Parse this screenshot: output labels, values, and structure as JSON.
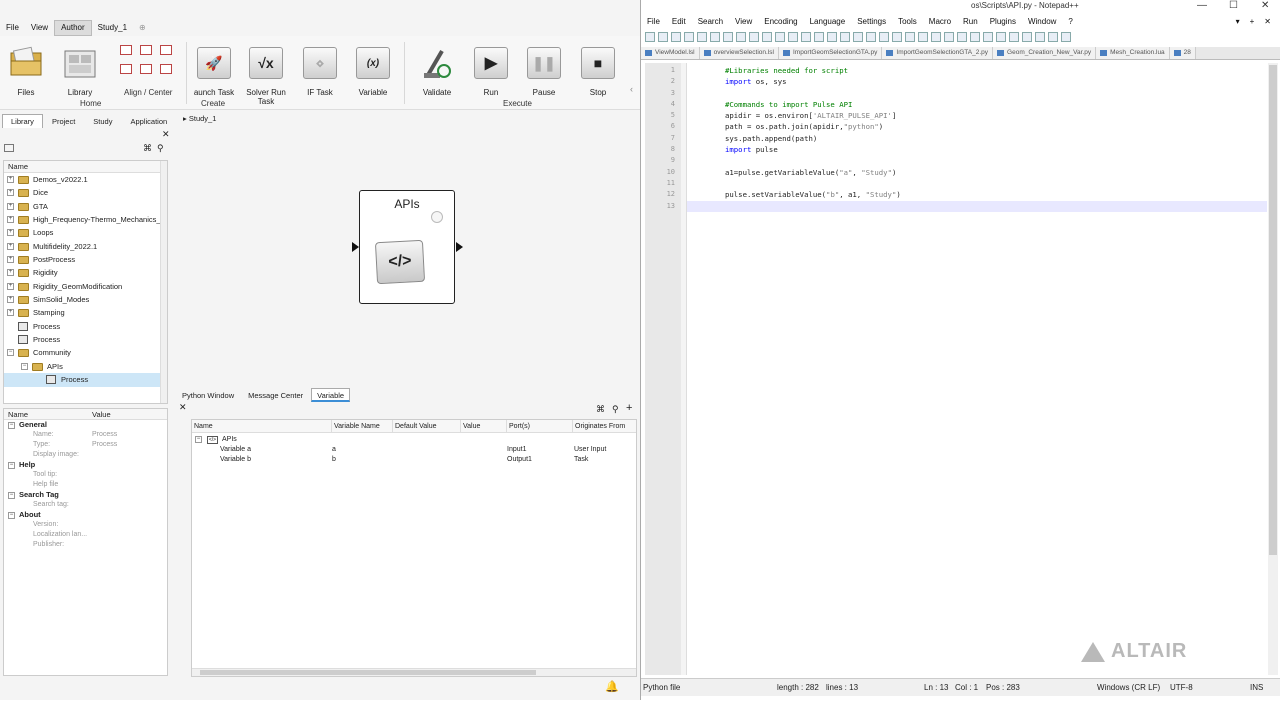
{
  "pulse": {
    "menu": [
      "File",
      "View",
      "Author",
      "Study_1"
    ],
    "ribbon": {
      "home": {
        "files": "Files",
        "library": "Library",
        "group": "Home"
      },
      "align": "Align / Center",
      "create": {
        "launch": "aunch Task",
        "solver": "Solver Run Task",
        "if": "IF Task",
        "variable": "Variable",
        "group": "Create"
      },
      "execute": {
        "validate": "Validate",
        "run": "Run",
        "pause": "Pause",
        "stop": "Stop",
        "group": "Execute"
      }
    },
    "left_tabs": [
      "Library",
      "Project",
      "Study",
      "Application"
    ],
    "tree": {
      "header": "Name",
      "items": [
        {
          "label": "Demos_v2022.1",
          "type": "folder"
        },
        {
          "label": "Dice",
          "type": "folder"
        },
        {
          "label": "GTA",
          "type": "folder"
        },
        {
          "label": "High_Frequency-Thermo_Mechanics_20",
          "type": "folder"
        },
        {
          "label": "Loops",
          "type": "folder"
        },
        {
          "label": "Multifidelity_2022.1",
          "type": "folder"
        },
        {
          "label": "PostProcess",
          "type": "folder"
        },
        {
          "label": "Rigidity",
          "type": "folder"
        },
        {
          "label": "Rigidity_GeomModification",
          "type": "folder"
        },
        {
          "label": "SimSolid_Modes",
          "type": "folder"
        },
        {
          "label": "Stamping",
          "type": "folder"
        },
        {
          "label": "Process",
          "type": "process"
        },
        {
          "label": "Process",
          "type": "process"
        },
        {
          "label": "Community",
          "type": "folder-open"
        },
        {
          "label": "APIs",
          "type": "folder-open-child"
        },
        {
          "label": "Process",
          "type": "process-child"
        }
      ]
    },
    "props": {
      "col_name": "Name",
      "col_value": "Value",
      "general": "General",
      "general_items": [
        {
          "k": "Name:",
          "v": "Process"
        },
        {
          "k": "Type:",
          "v": "Process"
        },
        {
          "k": "Display image:",
          "v": ""
        }
      ],
      "help": "Help",
      "help_items": [
        {
          "k": "Tool tip:"
        },
        {
          "k": "Help file"
        }
      ],
      "search": "Search Tag",
      "search_items": [
        {
          "k": "Search tag:"
        }
      ],
      "about": "About",
      "about_items": [
        {
          "k": "Version:"
        },
        {
          "k": "Localization lan..."
        },
        {
          "k": "Publisher:"
        }
      ]
    },
    "breadcrumb": "Study_1",
    "block_title": "APIs",
    "block_icon": "</>",
    "bottom_tabs": [
      "Python Window",
      "Message Center",
      "Variable"
    ],
    "variable_table": {
      "headers": [
        "Name",
        "Variable Name",
        "Default Value",
        "Value",
        "Port(s)",
        "Originates From"
      ],
      "group": "APIs",
      "rows": [
        {
          "name": "Variable a",
          "var": "a",
          "def": "",
          "val": "",
          "port": "Input1",
          "origin": "User Input"
        },
        {
          "name": "Variable b",
          "var": "b",
          "def": "",
          "val": "",
          "port": "Output1",
          "origin": "Task"
        }
      ]
    }
  },
  "npp": {
    "title": "os\\Scripts\\API.py - Notepad++",
    "menu": [
      "File",
      "Edit",
      "Search",
      "View",
      "Encoding",
      "Language",
      "Settings",
      "Tools",
      "Macro",
      "Run",
      "Plugins",
      "Window",
      "?"
    ],
    "tabs": [
      "ViewModel.lsl",
      "overviewSelection.lsl",
      "ImportGeomSelectionGTA.py",
      "ImportGeomSelectionGTA_2.py",
      "Geom_Creation_New_Var.py",
      "Mesh_Creation.lua",
      "28"
    ],
    "code": [
      {
        "n": "1",
        "parts": [
          {
            "c": "cm",
            "t": "#Libraries needed for script"
          }
        ]
      },
      {
        "n": "2",
        "parts": [
          {
            "c": "kw",
            "t": "import"
          },
          {
            "c": "",
            "t": " os, sys"
          }
        ]
      },
      {
        "n": "3",
        "parts": []
      },
      {
        "n": "4",
        "parts": [
          {
            "c": "cm",
            "t": "#Commands to import Pulse API"
          }
        ]
      },
      {
        "n": "5",
        "parts": [
          {
            "c": "",
            "t": "apidir = os.environ["
          },
          {
            "c": "st",
            "t": "'ALTAIR_PULSE_API'"
          },
          {
            "c": "",
            "t": "]"
          }
        ]
      },
      {
        "n": "6",
        "parts": [
          {
            "c": "",
            "t": "path = os.path.join(apidir,"
          },
          {
            "c": "st",
            "t": "\"python\""
          },
          {
            "c": "",
            "t": ")"
          }
        ]
      },
      {
        "n": "7",
        "parts": [
          {
            "c": "",
            "t": "sys.path.append(path)"
          }
        ]
      },
      {
        "n": "8",
        "parts": [
          {
            "c": "kw",
            "t": "import"
          },
          {
            "c": "",
            "t": " pulse"
          }
        ]
      },
      {
        "n": "9",
        "parts": []
      },
      {
        "n": "10",
        "parts": [
          {
            "c": "",
            "t": "a1=pulse.getVariableValue("
          },
          {
            "c": "st",
            "t": "\"a\""
          },
          {
            "c": "",
            "t": ", "
          },
          {
            "c": "st",
            "t": "\"Study\""
          },
          {
            "c": "",
            "t": ")"
          }
        ]
      },
      {
        "n": "11",
        "parts": []
      },
      {
        "n": "12",
        "parts": [
          {
            "c": "",
            "t": "pulse.setVariableValue("
          },
          {
            "c": "st",
            "t": "\"b\""
          },
          {
            "c": "",
            "t": ", a1, "
          },
          {
            "c": "st",
            "t": "\"Study\""
          },
          {
            "c": "",
            "t": ")"
          }
        ]
      },
      {
        "n": "13",
        "parts": []
      }
    ],
    "status": {
      "type": "Python file",
      "length": "length : 282",
      "lines": "lines : 13",
      "ln": "Ln : 13",
      "col": "Col : 1",
      "pos": "Pos : 283",
      "eol": "Windows (CR LF)",
      "enc": "UTF-8",
      "mode": "INS"
    },
    "watermark": "ALTAIR"
  }
}
